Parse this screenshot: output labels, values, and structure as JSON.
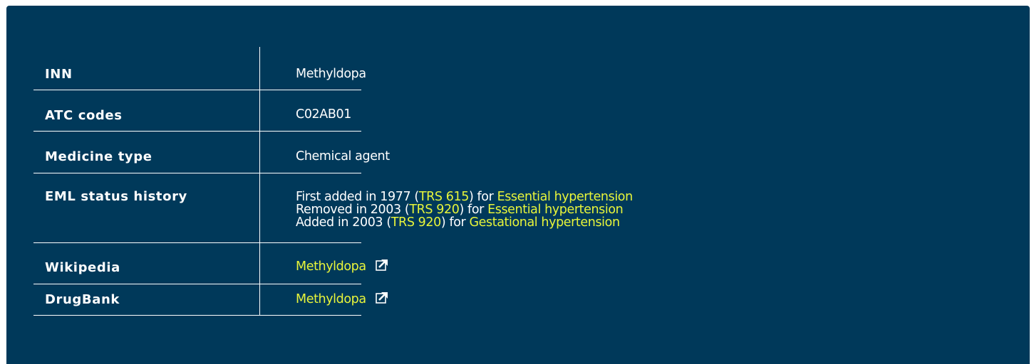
{
  "rows": {
    "inn": {
      "label": "INN",
      "value": "Methyldopa"
    },
    "atc": {
      "label": "ATC codes",
      "value": "C02AB01"
    },
    "medicine_type": {
      "label": "Medicine type",
      "value": "Chemical agent"
    },
    "eml_history": {
      "label": "EML status history",
      "entries": [
        {
          "prefix": "First added in 1977 (",
          "trs": "TRS 615",
          "mid": ") for ",
          "indication": "Essential hypertension"
        },
        {
          "prefix": "Removed in 2003 (",
          "trs": "TRS 920",
          "mid": ") for ",
          "indication": "Essential hypertension"
        },
        {
          "prefix": "Added in 2003 (",
          "trs": "TRS 920",
          "mid": ") for ",
          "indication": "Gestational hypertension"
        }
      ]
    },
    "wikipedia": {
      "label": "Wikipedia",
      "link": "Methyldopa",
      "icon": "external-link-icon"
    },
    "drugbank": {
      "label": "DrugBank",
      "link": "Methyldopa",
      "icon": "external-link-icon"
    }
  },
  "colors": {
    "panel_background": "#00395a",
    "text": "#ffffff",
    "link": "#e8f53a"
  }
}
